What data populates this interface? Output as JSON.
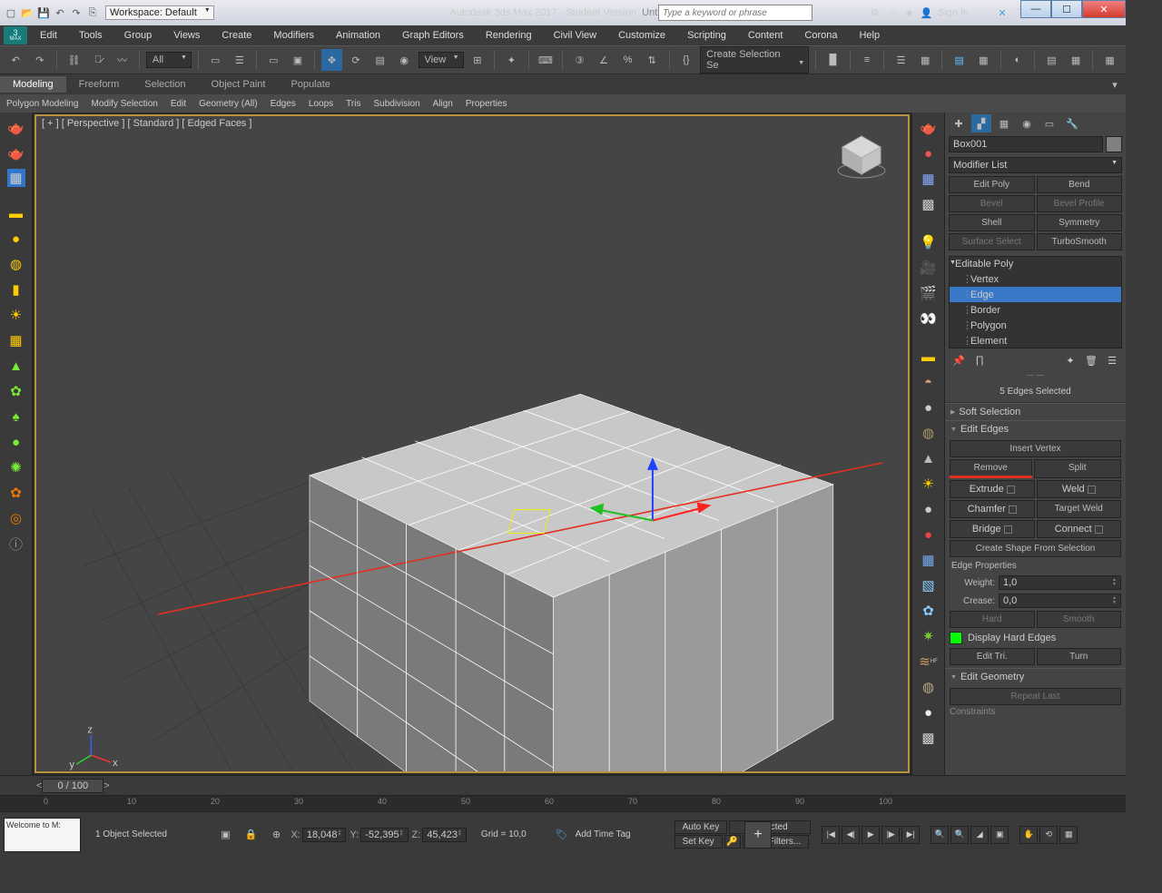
{
  "title": {
    "app": "Autodesk 3ds Max 2017 - Student Version",
    "doc": "Untitled",
    "workspace_label": "Workspace: Default"
  },
  "search": {
    "placeholder": "Type a keyword or phrase"
  },
  "signin": "Sign In",
  "menu": [
    "Edit",
    "Tools",
    "Group",
    "Views",
    "Create",
    "Modifiers",
    "Animation",
    "Graph Editors",
    "Rendering",
    "Civil View",
    "Customize",
    "Scripting",
    "Content",
    "Corona",
    "Help"
  ],
  "toolbar": {
    "all": "All",
    "view": "View",
    "selset": "Create Selection Se"
  },
  "ribbon": {
    "tabs": [
      "Modeling",
      "Freeform",
      "Selection",
      "Object Paint",
      "Populate"
    ],
    "sub": [
      "Polygon Modeling",
      "Modify Selection",
      "Edit",
      "Geometry (All)",
      "Edges",
      "Loops",
      "Tris",
      "Subdivision",
      "Align",
      "Properties"
    ]
  },
  "viewport": {
    "label": "[ + ] [ Perspective ] [ Standard ] [ Edged Faces ]"
  },
  "cmd": {
    "object_name": "Box001",
    "modifier_list": "Modifier List",
    "mod_buttons": [
      [
        "Edit Poly",
        "Bend"
      ],
      [
        "Bevel",
        "Bevel Profile"
      ],
      [
        "Shell",
        "Symmetry"
      ],
      [
        "Surface Select",
        "TurboSmooth"
      ]
    ],
    "stack": [
      "Editable Poly",
      "Vertex",
      "Edge",
      "Border",
      "Polygon",
      "Element"
    ],
    "selection_count": "5 Edges Selected",
    "soft_sel": "Soft Selection",
    "edit_edges": {
      "title": "Edit Edges",
      "insert_vertex": "Insert Vertex",
      "remove": "Remove",
      "split": "Split",
      "extrude": "Extrude",
      "weld": "Weld",
      "chamfer": "Chamfer",
      "target_weld": "Target Weld",
      "bridge": "Bridge",
      "connect": "Connect",
      "create_shape": "Create Shape From Selection",
      "edge_props": "Edge Properties",
      "weight": "Weight:",
      "weight_val": "1,0",
      "crease": "Crease:",
      "crease_val": "0,0",
      "hard": "Hard",
      "smooth": "Smooth",
      "display_hard": "Display Hard Edges",
      "edit_tri": "Edit Tri.",
      "turn": "Turn"
    },
    "edit_geom": {
      "title": "Edit Geometry",
      "repeat": "Repeat Last",
      "constraints": "Constraints"
    }
  },
  "timeline": {
    "pos": "0 / 100",
    "ticks": [
      "0",
      "10",
      "20",
      "30",
      "40",
      "50",
      "60",
      "70",
      "80",
      "90",
      "100"
    ]
  },
  "status": {
    "welcome": "Welcome to M:",
    "selected": "1 Object Selected",
    "x": "18,048",
    "y": "-52,395",
    "z": "45,423",
    "grid": "Grid = 10,0",
    "add_time_tag": "Add Time Tag",
    "autokey": "Auto Key",
    "setkey": "Set Key",
    "selected_dd": "Selected",
    "keyfilters": "Key Filters..."
  }
}
